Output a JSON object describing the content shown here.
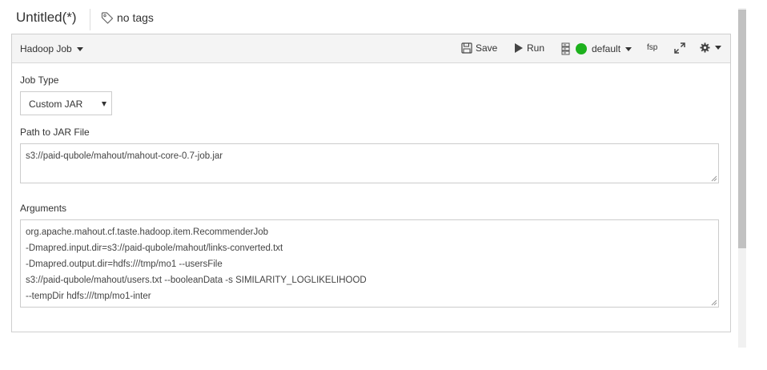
{
  "header": {
    "title": "Untitled(*)",
    "tags_label": "no tags"
  },
  "toolbar": {
    "type_label": "Hadoop Job",
    "save_label": "Save",
    "run_label": "Run",
    "cluster_label": "default",
    "cluster_status_color": "#1db11d",
    "fsp_label": "fsp"
  },
  "form": {
    "job_type_label": "Job Type",
    "job_type_value": "Custom JAR",
    "jar_path_label": "Path to JAR File",
    "jar_path_value": "s3://paid-qubole/mahout/mahout-core-0.7-job.jar",
    "arguments_label": "Arguments",
    "arguments_lines": [
      "org.apache.mahout.cf.taste.hadoop.item.RecommenderJob",
      "-Dmapred.input.dir=s3://paid-qubole/mahout/links-converted.txt",
      "-Dmapred.output.dir=hdfs:///tmp/mo1 --usersFile",
      "s3://paid-qubole/mahout/users.txt --booleanData -s SIMILARITY_LOGLIKELIHOOD",
      "--tempDir hdfs:///tmp/mo1-inter"
    ]
  },
  "icons": {
    "tag": "tag-icon",
    "save": "floppy-disk-icon",
    "run": "play-icon",
    "cluster": "server-icon",
    "expand": "expand-arrows-icon",
    "settings": "gear-icon"
  }
}
